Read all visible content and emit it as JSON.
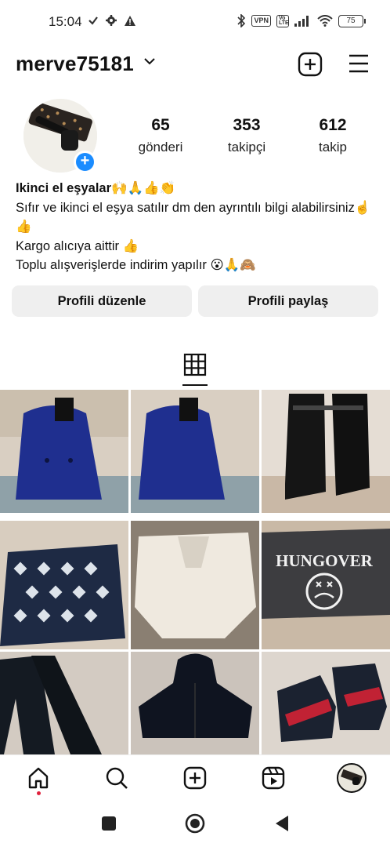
{
  "status_bar": {
    "time": "15:04",
    "vpn": "VPN",
    "lte": "Vo LTE",
    "battery": "75"
  },
  "header": {
    "username": "merve75181"
  },
  "stats": [
    {
      "value": "65",
      "label": "gönderi"
    },
    {
      "value": "353",
      "label": "takipçi"
    },
    {
      "value": "612",
      "label": "takip"
    }
  ],
  "bio": {
    "name": "Ikinci el eşyalar🙌🙏👍👏",
    "line1": "Sıfır ve ikinci el eşya satılır dm den ayrıntılı bilgi alabilirsiniz☝️👍",
    "line2": "Kargo alıcıya aittir 👍",
    "line3": "Toplu alışverişlerde indirim yapılır 😮🙏🙈"
  },
  "buttons": {
    "edit_profile": "Profili düzenle",
    "share_profile": "Profili paylaş"
  },
  "posts": [
    {
      "alt": "blue coat photo"
    },
    {
      "alt": "blue coat photo"
    },
    {
      "alt": "black rain boots"
    },
    {
      "alt": "patterned blouse"
    },
    {
      "alt": "white cardigan"
    },
    {
      "alt": "HUNGOVER grey top",
      "text": "HUNGOVER"
    },
    {
      "alt": "black trousers"
    },
    {
      "alt": "black jacket"
    },
    {
      "alt": "sneakers"
    }
  ],
  "colors": {
    "accent_blue": "#1a8cff",
    "button_bg": "#efefef",
    "notification_red": "#e0213c"
  },
  "icons": [
    "home-icon",
    "search-icon",
    "create-icon",
    "reels-icon",
    "profile-avatar-icon"
  ]
}
